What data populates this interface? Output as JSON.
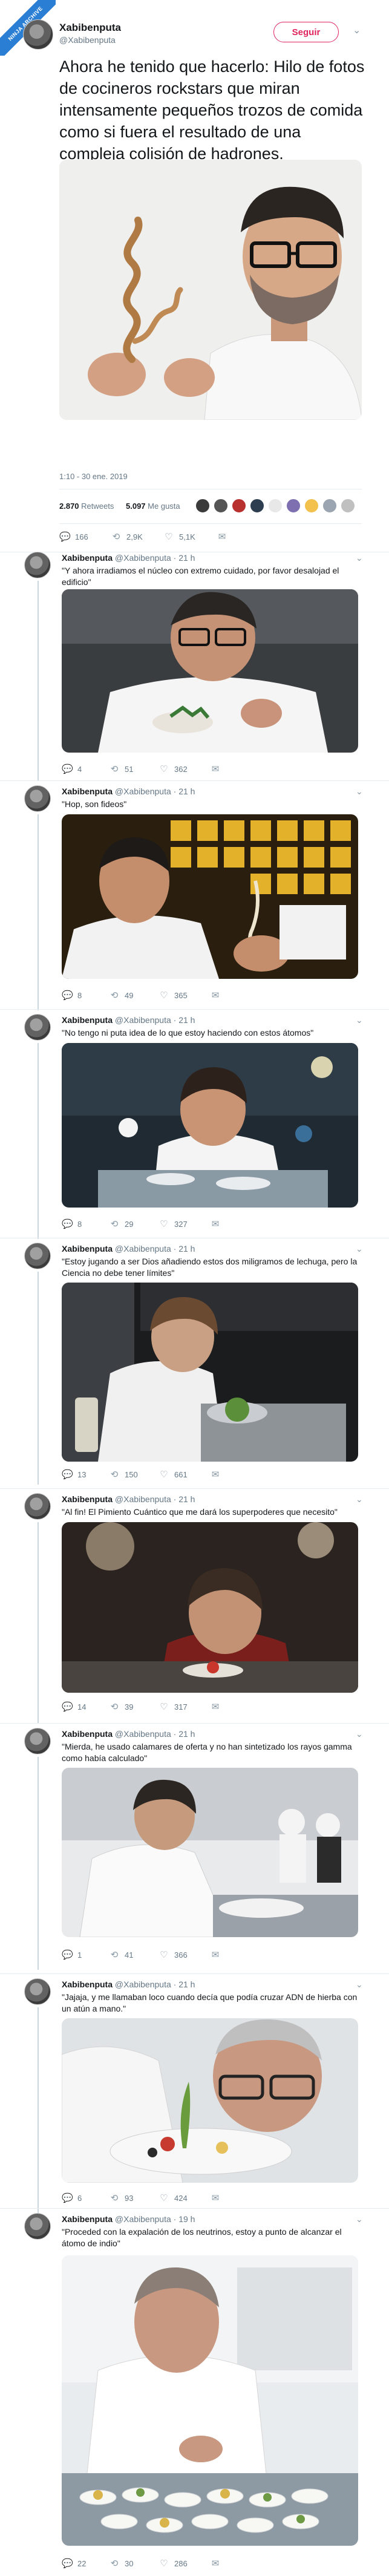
{
  "badge": "NINJA ARCHIVE",
  "main": {
    "author_name": "Xabibenputa",
    "author_handle": "@Xabibenputa",
    "follow_label": "Seguir",
    "text": "Ahora he tenido que hacerlo: Hilo de fotos de cocineros rockstars que miran intensamente pequeños trozos de comida como si fuera el resultado de una compleja colisión de hadrones.",
    "timestamp": "1:10 - 30 ene. 2019",
    "retweets_count": "2.870",
    "retweets_label": "Retweets",
    "likes_count": "5.097",
    "likes_label": "Me gusta",
    "replies": "166",
    "rts": "2,9K",
    "likes": "5,1K"
  },
  "replies": [
    {
      "name": "Xabibenputa",
      "handle": "@Xabibenputa",
      "time": "· 21 h",
      "text": "\"Y ahora irradiamos el núcleo con extremo cuidado, por favor desalojad el edificio\"",
      "replies": "4",
      "rts": "51",
      "likes": "362"
    },
    {
      "name": "Xabibenputa",
      "handle": "@Xabibenputa",
      "time": "· 21 h",
      "text": "\"Hop, son fideos\"",
      "replies": "8",
      "rts": "49",
      "likes": "365"
    },
    {
      "name": "Xabibenputa",
      "handle": "@Xabibenputa",
      "time": "· 21 h",
      "text": "\"No tengo ni puta idea de lo que estoy haciendo con estos átomos\"",
      "replies": "8",
      "rts": "29",
      "likes": "327"
    },
    {
      "name": "Xabibenputa",
      "handle": "@Xabibenputa",
      "time": "· 21 h",
      "text": "\"Estoy jugando a ser Dios añadiendo estos dos miligramos de lechuga, pero la Ciencia no debe tener límites\"",
      "replies": "13",
      "rts": "150",
      "likes": "661"
    },
    {
      "name": "Xabibenputa",
      "handle": "@Xabibenputa",
      "time": "· 21 h",
      "text": "\"Al fin! El Pimiento Cuántico que me dará los superpoderes que necesito\"",
      "replies": "14",
      "rts": "39",
      "likes": "317"
    },
    {
      "name": "Xabibenputa",
      "handle": "@Xabibenputa",
      "time": "· 21 h",
      "text": "\"Mierda, he usado calamares de oferta y no han sintetizado los rayos gamma como había calculado\"",
      "replies": "1",
      "rts": "41",
      "likes": "366"
    },
    {
      "name": "Xabibenputa",
      "handle": "@Xabibenputa",
      "time": "· 21 h",
      "text": "\"Jajaja, y me llamaban loco cuando decía que podía cruzar ADN de hierba con un atún a mano.\"",
      "replies": "6",
      "rts": "93",
      "likes": "424"
    },
    {
      "name": "Xabibenputa",
      "handle": "@Xabibenputa",
      "time": "· 19 h",
      "text": "\"Proceded con la expalación de los neutrinos, estoy a punto de alcanzar el átomo de indio\"",
      "replies": "22",
      "rts": "30",
      "likes": "286"
    }
  ],
  "colors": {
    "follow": "#e0245e",
    "link": "#1da1f2",
    "muted": "#657786"
  }
}
